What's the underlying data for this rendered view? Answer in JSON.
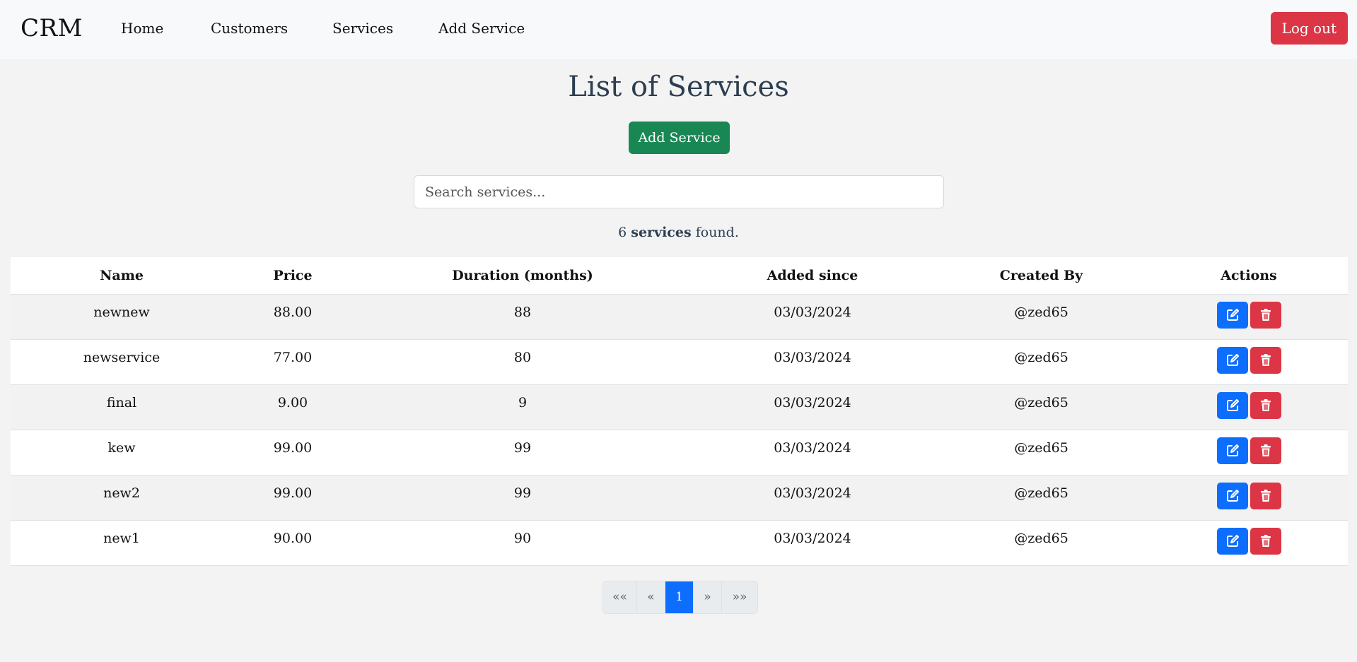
{
  "nav": {
    "brand": "CRM",
    "links": [
      "Home",
      "Customers",
      "Services",
      "Add Service"
    ],
    "logout_label": "Log out"
  },
  "main": {
    "title": "List of Services",
    "add_button_label": "Add Service",
    "search_placeholder": "Search services...",
    "found_count": "6",
    "found_bold": "services",
    "found_suffix": "found."
  },
  "table": {
    "headers": [
      "Name",
      "Price",
      "Duration (months)",
      "Added since",
      "Created By",
      "Actions"
    ],
    "rows": [
      [
        "newnew",
        "88.00",
        "88",
        "03/03/2024",
        "@zed65"
      ],
      [
        "newservice",
        "77.00",
        "80",
        "03/03/2024",
        "@zed65"
      ],
      [
        "final",
        "9.00",
        "9",
        "03/03/2024",
        "@zed65"
      ],
      [
        "kew",
        "99.00",
        "99",
        "03/03/2024",
        "@zed65"
      ],
      [
        "new2",
        "99.00",
        "99",
        "03/03/2024",
        "@zed65"
      ],
      [
        "new1",
        "90.00",
        "90",
        "03/03/2024",
        "@zed65"
      ]
    ]
  },
  "pagination": {
    "first": "««",
    "prev": "«",
    "current": "1",
    "next": "»",
    "last": "»»"
  },
  "icons": {
    "edit": "edit-icon",
    "delete": "trash-icon"
  },
  "colors": {
    "primary": "#0d6efd",
    "danger": "#dc3545",
    "success": "#198754"
  }
}
